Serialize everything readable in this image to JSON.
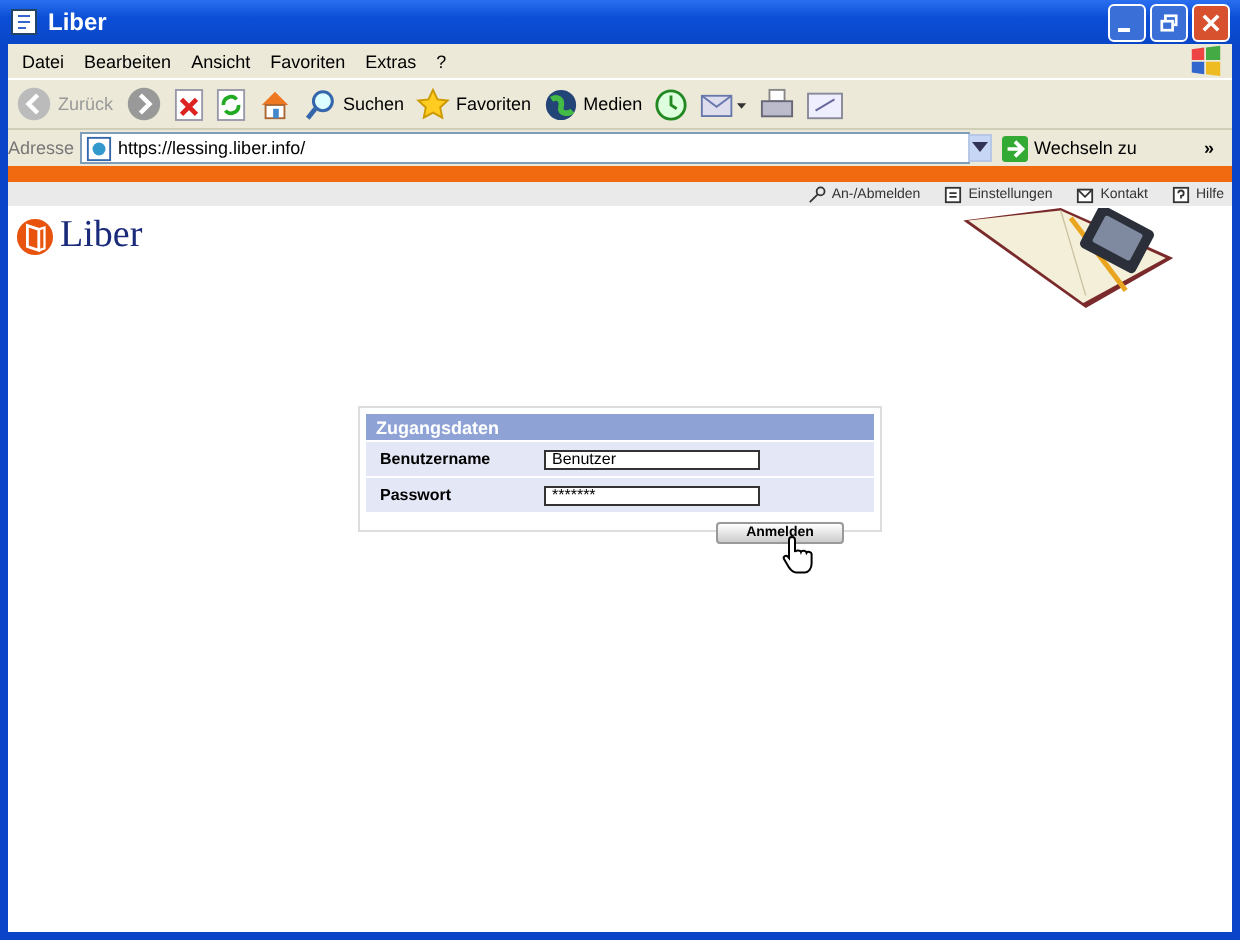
{
  "window": {
    "title": "Liber"
  },
  "menu": [
    "Datei",
    "Bearbeiten",
    "Ansicht",
    "Favoriten",
    "Extras",
    "?"
  ],
  "toolbar": [
    {
      "kind": "back",
      "label": "Zurück",
      "disabled": true
    },
    {
      "kind": "forward",
      "disabled": false
    },
    {
      "kind": "stop"
    },
    {
      "kind": "refresh"
    },
    {
      "kind": "home"
    },
    {
      "kind": "search",
      "label": "Suchen"
    },
    {
      "kind": "favorites",
      "label": "Favoriten"
    },
    {
      "kind": "media",
      "label": "Medien"
    },
    {
      "kind": "history"
    },
    {
      "kind": "mail"
    },
    {
      "kind": "print"
    },
    {
      "kind": "edit"
    }
  ],
  "address": {
    "label": "Adresse",
    "value": "https://lessing.liber.info/",
    "go": "Wechseln zu",
    "more": "»"
  },
  "site_nav": [
    {
      "kind": "key",
      "label": "An-/Abmelden"
    },
    {
      "kind": "settings",
      "label": "Einstellungen"
    },
    {
      "kind": "contact",
      "label": "Kontakt"
    },
    {
      "kind": "help",
      "label": "Hilfe"
    }
  ],
  "logo": {
    "text": "Liber"
  },
  "login": {
    "title": "Zugangsdaten",
    "fields": [
      {
        "label": "Benutzername",
        "value": "Benutzer"
      },
      {
        "label": "Passwort",
        "value": "*******"
      }
    ],
    "submit": "Anmelden"
  }
}
